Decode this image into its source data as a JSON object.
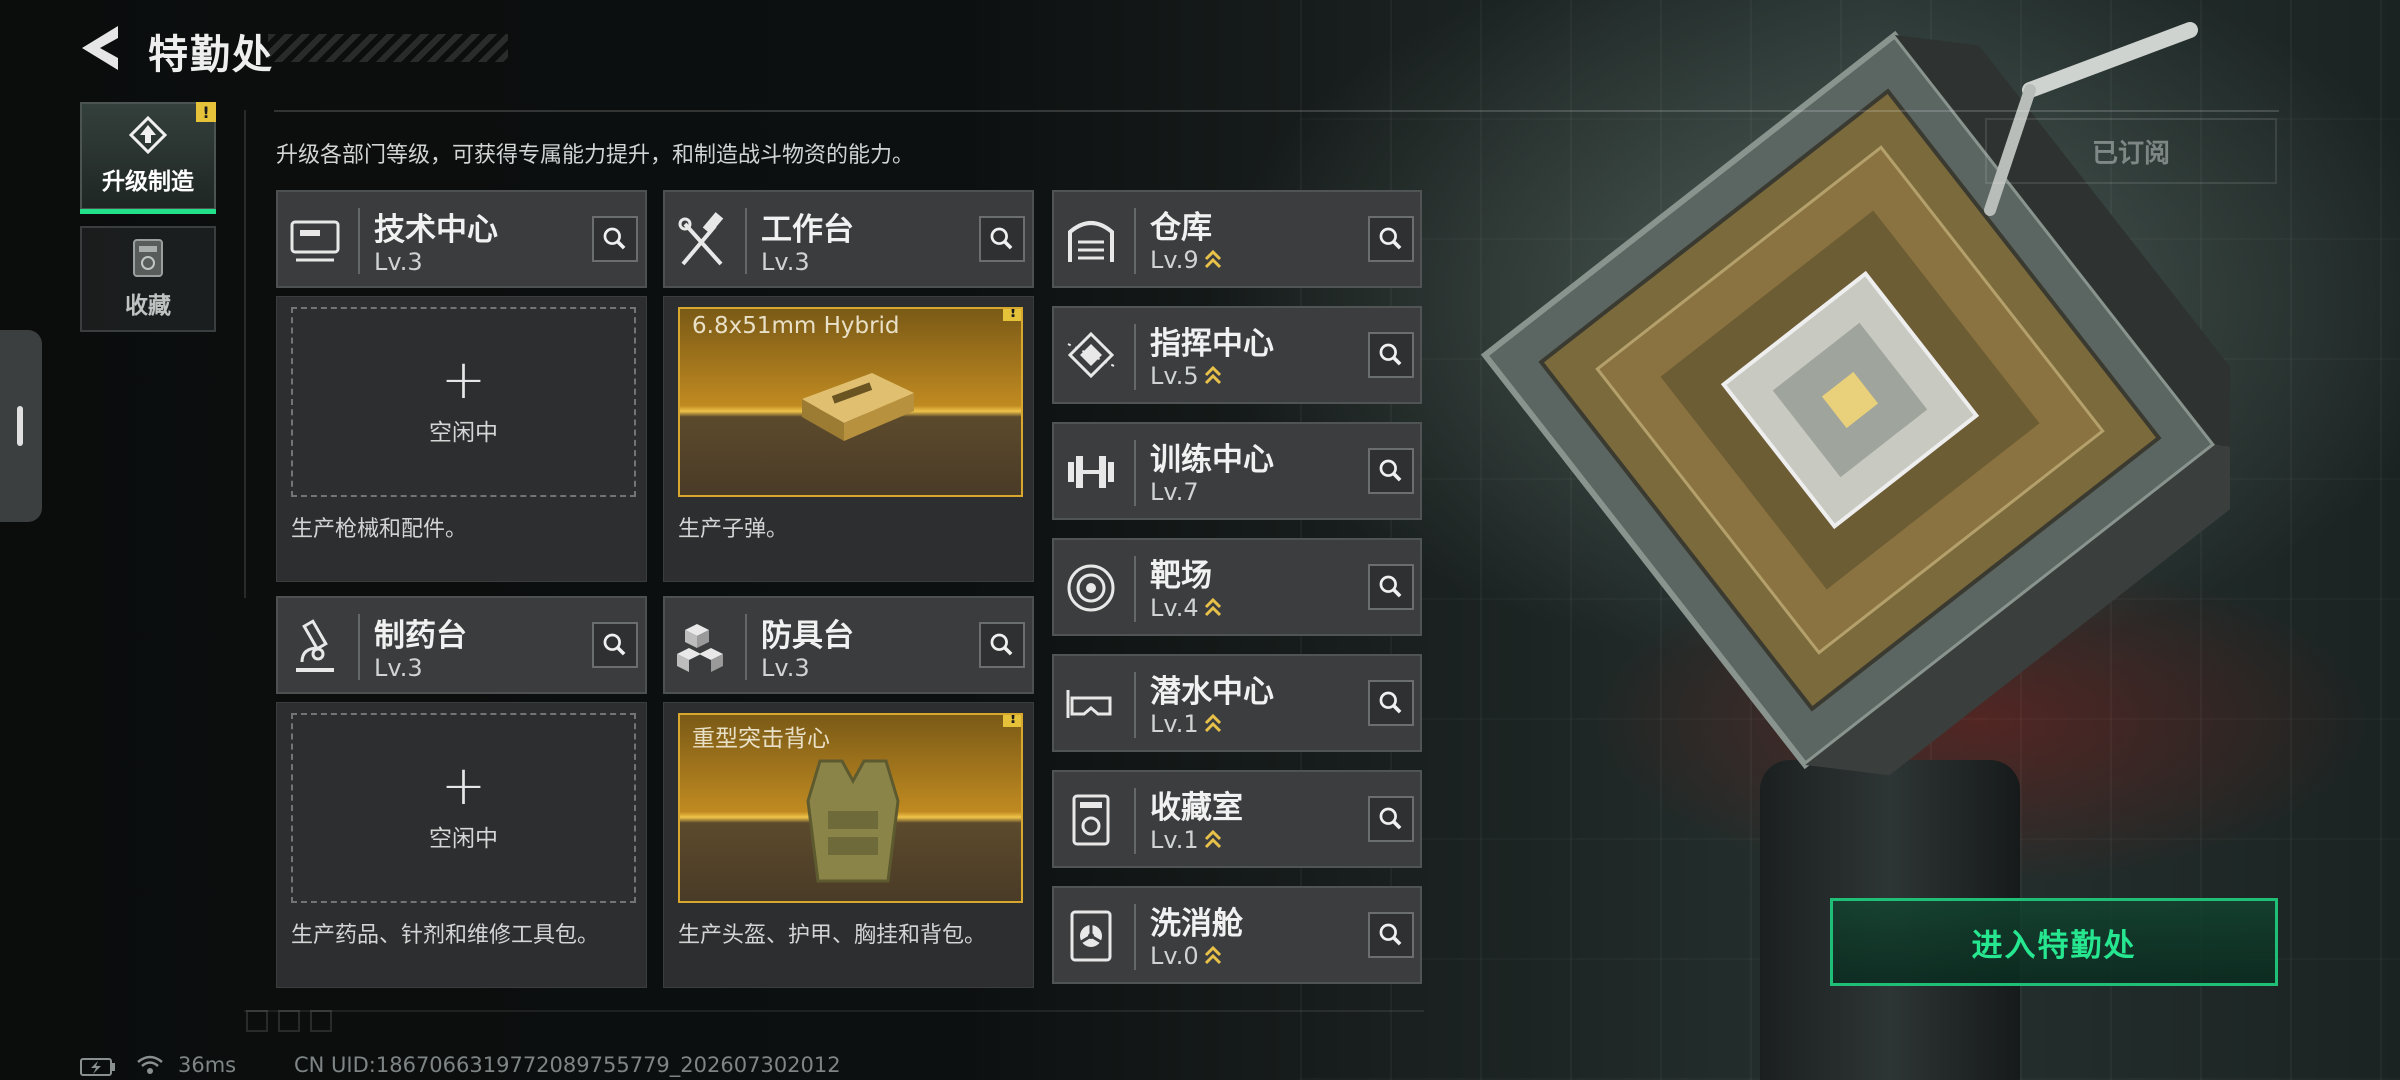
{
  "header": {
    "title": "特勤处"
  },
  "sidebar": {
    "tabs": [
      {
        "label": "升级制造",
        "active": true,
        "alert": true
      },
      {
        "label": "收藏",
        "active": false,
        "alert": false
      }
    ]
  },
  "intro": "升级各部门等级，可获得专属能力提升，和制造战斗物资的能力。",
  "subscription_label": "已订阅",
  "alert_mark": "!",
  "production_cards": [
    {
      "name": "技术中心",
      "level": "Lv.3",
      "icon": "computer-icon",
      "state": "idle",
      "idle_label": "空闲中",
      "desc": "生产枪械和配件。"
    },
    {
      "name": "工作台",
      "level": "Lv.3",
      "icon": "hammer-wrench-icon",
      "state": "producing",
      "item": "6.8x51mm Hybrid",
      "desc": "生产子弹。"
    },
    {
      "name": "制药台",
      "level": "Lv.3",
      "icon": "microscope-icon",
      "state": "idle",
      "idle_label": "空闲中",
      "desc": "生产药品、针剂和维修工具包。"
    },
    {
      "name": "防具台",
      "level": "Lv.3",
      "icon": "armor-blocks-icon",
      "state": "producing",
      "item": "重型突击背心",
      "desc": "生产头盔、护甲、胸挂和背包。"
    }
  ],
  "facilities": [
    {
      "name": "仓库",
      "level": "Lv.9",
      "icon": "warehouse-icon",
      "upgradable": true
    },
    {
      "name": "指挥中心",
      "level": "Lv.5",
      "icon": "chip-icon",
      "upgradable": true
    },
    {
      "name": "训练中心",
      "level": "Lv.7",
      "icon": "dumbbell-icon",
      "upgradable": false
    },
    {
      "name": "靶场",
      "level": "Lv.4",
      "icon": "target-icon",
      "upgradable": true
    },
    {
      "name": "潜水中心",
      "level": "Lv.1",
      "icon": "diving-mask-icon",
      "upgradable": true
    },
    {
      "name": "收藏室",
      "level": "Lv.1",
      "icon": "collection-icon",
      "upgradable": true
    },
    {
      "name": "洗消舱",
      "level": "Lv.0",
      "icon": "radiation-icon",
      "upgradable": true
    }
  ],
  "enter_button": "进入特勤处",
  "footer": {
    "ping": "36ms",
    "uid": "CN UID:1867066319772089755779_202607302012"
  },
  "colors": {
    "accent_green": "#22e08a",
    "alert_yellow": "#e5c23a",
    "upgrade_gold": "#e8c14a"
  }
}
